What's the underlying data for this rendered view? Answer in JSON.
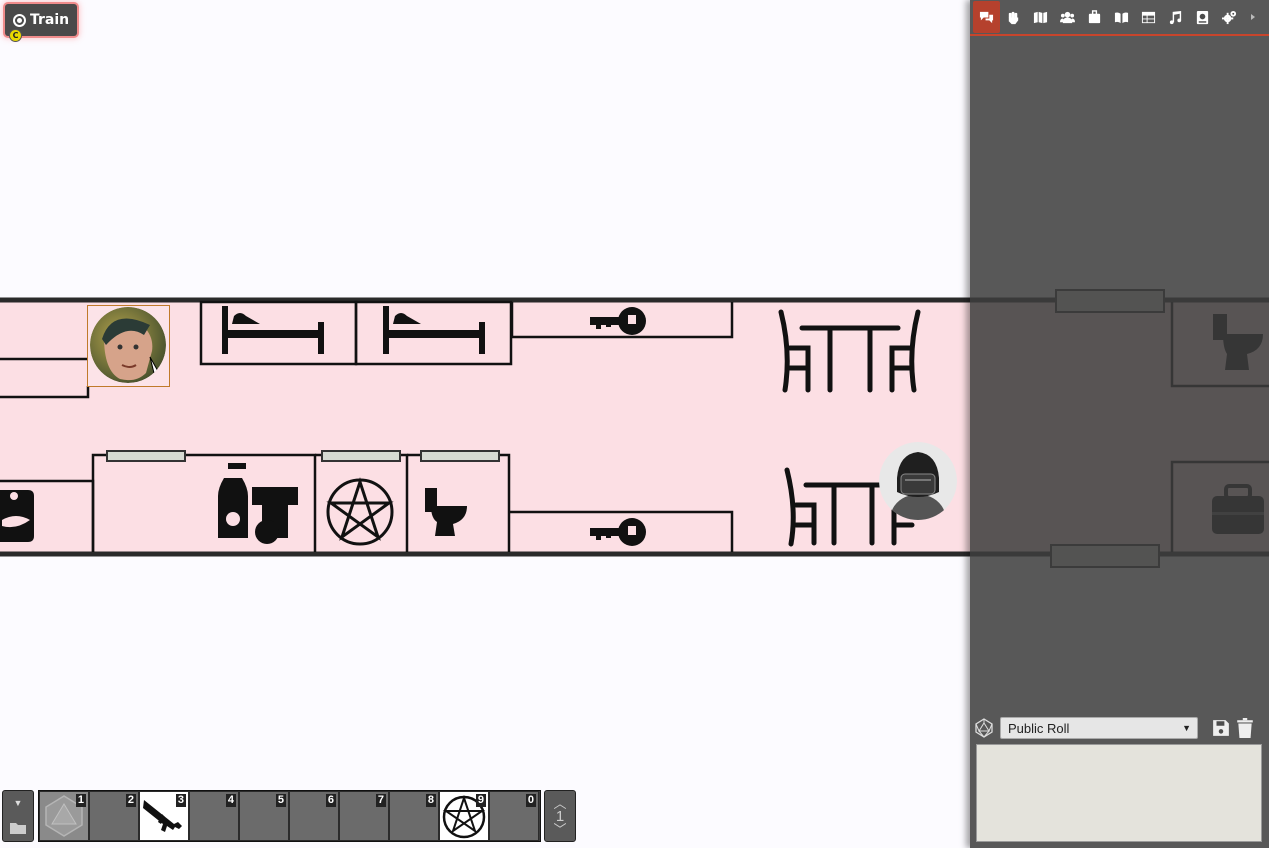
{
  "scene": {
    "label": "Train",
    "badge": "C"
  },
  "sidebar": {
    "tabs": [
      {
        "name": "tab-chat",
        "icon": "chat-bubbles-icon"
      },
      {
        "name": "tab-combat",
        "icon": "fist-icon"
      },
      {
        "name": "tab-scenes",
        "icon": "map-icon"
      },
      {
        "name": "tab-actors",
        "icon": "users-icon"
      },
      {
        "name": "tab-items",
        "icon": "suitcase-icon"
      },
      {
        "name": "tab-journal",
        "icon": "book-open-icon"
      },
      {
        "name": "tab-tables",
        "icon": "table-icon"
      },
      {
        "name": "tab-playlists",
        "icon": "music-icon"
      },
      {
        "name": "tab-compendium",
        "icon": "atlas-icon"
      },
      {
        "name": "tab-settings",
        "icon": "cogs-icon"
      }
    ],
    "collapse_icon": "caret-right-icon"
  },
  "chat": {
    "roll_mode": "Public Roll",
    "roll_icon": "d20-icon",
    "save_icon": "save-icon",
    "delete_icon": "trash-icon",
    "message_value": ""
  },
  "hotbar": {
    "slots": [
      {
        "num": "1",
        "macro": "d20-dice"
      },
      {
        "num": "2",
        "macro": ""
      },
      {
        "num": "3",
        "macro": "assault-rifle"
      },
      {
        "num": "4",
        "macro": ""
      },
      {
        "num": "5",
        "macro": ""
      },
      {
        "num": "6",
        "macro": ""
      },
      {
        "num": "7",
        "macro": ""
      },
      {
        "num": "8",
        "macro": ""
      },
      {
        "num": "9",
        "macro": "pentagram"
      },
      {
        "num": "0",
        "macro": ""
      }
    ],
    "page": "1"
  },
  "colors": {
    "floor": "#fcdfe4",
    "wall": "#2a2a2a",
    "sidebar": "#4c4c4c",
    "active_tab": "#b5412d"
  }
}
